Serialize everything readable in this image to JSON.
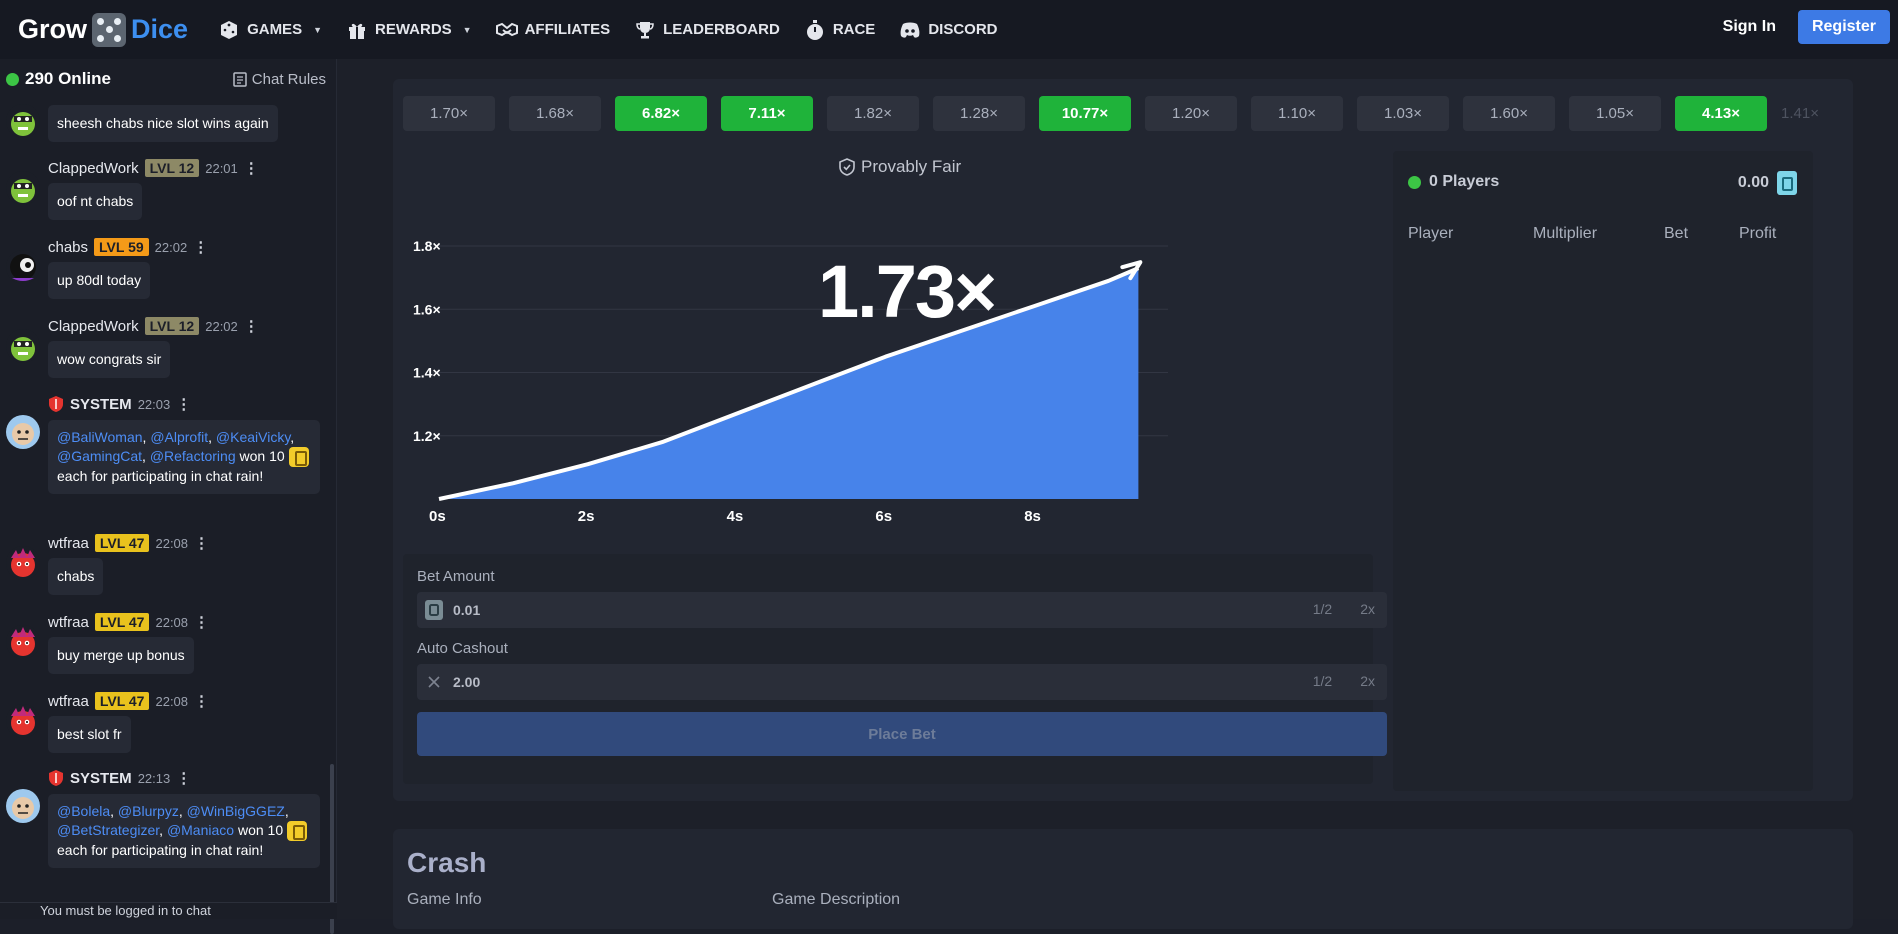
{
  "brand": {
    "grow": "Grow",
    "dice": "Dice"
  },
  "nav": [
    {
      "label": "GAMES",
      "icon": "dice-icon",
      "has_caret": true
    },
    {
      "label": "REWARDS",
      "icon": "gift-icon",
      "has_caret": true
    },
    {
      "label": "AFFILIATES",
      "icon": "handshake-icon",
      "has_caret": false
    },
    {
      "label": "LEADERBOARD",
      "icon": "trophy-icon",
      "has_caret": false
    },
    {
      "label": "RACE",
      "icon": "stopwatch-icon",
      "has_caret": false
    },
    {
      "label": "DISCORD",
      "icon": "discord-icon",
      "has_caret": false
    }
  ],
  "auth": {
    "signin": "Sign In",
    "register": "Register"
  },
  "chat": {
    "online": "290 Online",
    "rules": "Chat Rules",
    "messages": [
      {
        "user": "",
        "text": "sheesh chabs nice slot wins again"
      },
      {
        "user": "ClappedWork",
        "level": "LVL 12",
        "level_color": "tan",
        "time": "22:01",
        "text": "oof nt chabs"
      },
      {
        "user": "chabs",
        "level": "LVL 59",
        "level_color": "orange",
        "time": "22:02",
        "text": "up 80dl today"
      },
      {
        "user": "ClappedWork",
        "level": "LVL 12",
        "level_color": "tan",
        "time": "22:02",
        "text": "wow congrats sir"
      },
      {
        "user": "SYSTEM",
        "time": "22:03",
        "mentions": [
          "@BaliWoman",
          "@Alprofit",
          "@KeaiVicky",
          "@GamingCat",
          "@Refactoring"
        ],
        "text_a": "won 10",
        "text_b": "each for participating in chat rain!"
      },
      {
        "user": "wtfraa",
        "level": "LVL 47",
        "level_color": "yellow",
        "time": "22:08",
        "text": "chabs"
      },
      {
        "user": "wtfraa",
        "level": "LVL 47",
        "level_color": "yellow",
        "time": "22:08",
        "text": "buy merge up bonus"
      },
      {
        "user": "wtfraa",
        "level": "LVL 47",
        "level_color": "yellow",
        "time": "22:08",
        "text": "best slot fr"
      },
      {
        "user": "SYSTEM",
        "time": "22:13",
        "mentions": [
          "@Bolela",
          "@Blurpyz",
          "@WinBigGGEZ",
          "@BetStrategizer",
          "@Maniaco"
        ],
        "text_a": "won 10",
        "text_b": "each for participating in chat rain!"
      }
    ],
    "bottom_notice": "You must be logged in to chat"
  },
  "history": [
    {
      "value": "1.70×",
      "win": false
    },
    {
      "value": "1.68×",
      "win": false
    },
    {
      "value": "6.82×",
      "win": true
    },
    {
      "value": "7.11×",
      "win": true
    },
    {
      "value": "1.82×",
      "win": false
    },
    {
      "value": "1.28×",
      "win": false
    },
    {
      "value": "10.77×",
      "win": true
    },
    {
      "value": "1.20×",
      "win": false
    },
    {
      "value": "1.10×",
      "win": false
    },
    {
      "value": "1.03×",
      "win": false
    },
    {
      "value": "1.60×",
      "win": false
    },
    {
      "value": "1.05×",
      "win": false
    },
    {
      "value": "4.13×",
      "win": true
    },
    {
      "value": "1.41×",
      "win": false
    }
  ],
  "game": {
    "provably_fair": "Provably Fair",
    "current_multiplier": "1.73×",
    "curve": {
      "x_seconds": [
        0,
        1,
        2,
        3,
        4,
        5,
        6,
        7,
        8,
        9,
        9.4
      ],
      "y_multiplier": [
        1.0,
        1.05,
        1.11,
        1.18,
        1.27,
        1.36,
        1.45,
        1.53,
        1.61,
        1.69,
        1.73
      ],
      "y_ticks": [
        "1.8×",
        "1.6×",
        "1.4×",
        "1.2×"
      ],
      "x_ticks": [
        "0s",
        "2s",
        "4s",
        "6s",
        "8s"
      ],
      "fill_color": "#4783ea",
      "line_color": "#ffffff"
    }
  },
  "bet": {
    "amount_label": "Bet Amount",
    "amount_value": "0.01",
    "cashout_label": "Auto Cashout",
    "cashout_value": "2.00",
    "half": "1/2",
    "double": "2x",
    "place_bet": "Place Bet"
  },
  "players": {
    "count_label": "0 Players",
    "total": "0.00",
    "columns": [
      "Player",
      "Multiplier",
      "Bet",
      "Profit"
    ]
  },
  "info": {
    "title": "Crash",
    "tabs": [
      "Game Info",
      "Game Description"
    ]
  }
}
